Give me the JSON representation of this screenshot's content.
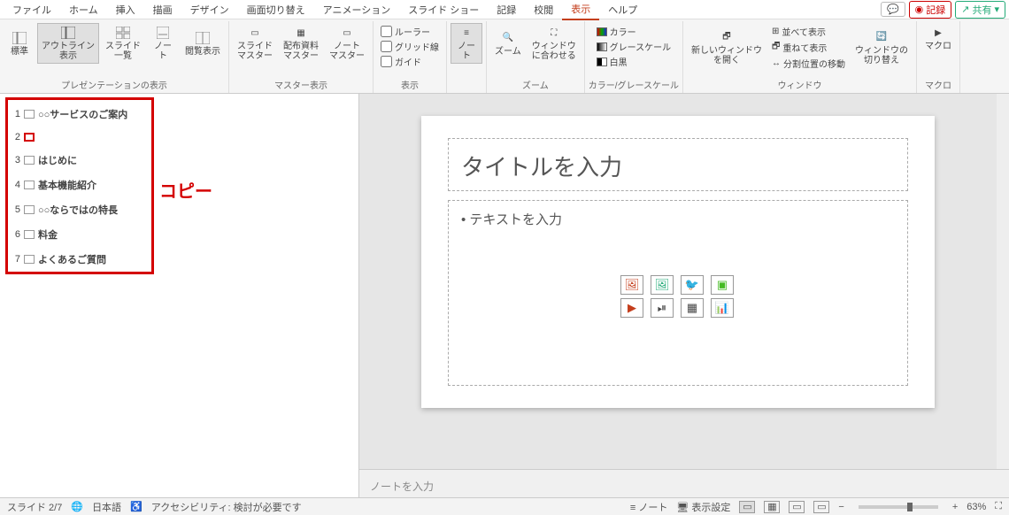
{
  "menu": {
    "tabs": [
      "ファイル",
      "ホーム",
      "挿入",
      "描画",
      "デザイン",
      "画面切り替え",
      "アニメーション",
      "スライド ショー",
      "記録",
      "校閲",
      "表示",
      "ヘルプ"
    ],
    "active_index": 10,
    "record_btn": "記録",
    "share_btn": "共有"
  },
  "ribbon": {
    "g1": {
      "label": "プレゼンテーションの表示",
      "items": [
        "標準",
        "アウトライン\n表示",
        "スライド\n一覧",
        "ノー\nト",
        "閲覧表示"
      ]
    },
    "g2": {
      "label": "マスター表示",
      "items": [
        "スライド\nマスター",
        "配布資料\nマスター",
        "ノート\nマスター"
      ]
    },
    "g3": {
      "label": "表示",
      "checks": [
        "ルーラー",
        "グリッド線",
        "ガイド"
      ]
    },
    "g4": {
      "label": "",
      "items": [
        "ノー\nト"
      ]
    },
    "g5": {
      "label": "ズーム",
      "items": [
        "ズーム",
        "ウィンドウ\nに合わせる"
      ]
    },
    "g6": {
      "label": "カラー/グレースケール",
      "items": [
        "カラー",
        "グレースケール",
        "白黒"
      ]
    },
    "g7": {
      "label": "ウィンドウ",
      "new": "新しいウィンドウ\nを開く",
      "opts": [
        "並べて表示",
        "重ねて表示",
        "分割位置の移動"
      ],
      "switch": "ウィンドウの\n切り替え"
    },
    "g8": {
      "label": "マクロ",
      "items": [
        "マクロ"
      ]
    }
  },
  "outline": {
    "items": [
      {
        "n": "1",
        "t": "○○サービスのご案内"
      },
      {
        "n": "2",
        "t": ""
      },
      {
        "n": "3",
        "t": "はじめに"
      },
      {
        "n": "4",
        "t": "基本機能紹介"
      },
      {
        "n": "5",
        "t": "○○ならではの特長"
      },
      {
        "n": "6",
        "t": "料金"
      },
      {
        "n": "7",
        "t": "よくあるご質問"
      }
    ],
    "selected_index": 1,
    "annotation": "コピー"
  },
  "slide": {
    "title_placeholder": "タイトルを入力",
    "body_placeholder": "• テキストを入力"
  },
  "notes": {
    "placeholder": "ノートを入力"
  },
  "status": {
    "slide": "スライド 2/7",
    "lang": "日本語",
    "acc": "アクセシビリティ: 検討が必要です",
    "notes_btn": "ノート",
    "display_btn": "表示設定",
    "zoom": "63%"
  }
}
